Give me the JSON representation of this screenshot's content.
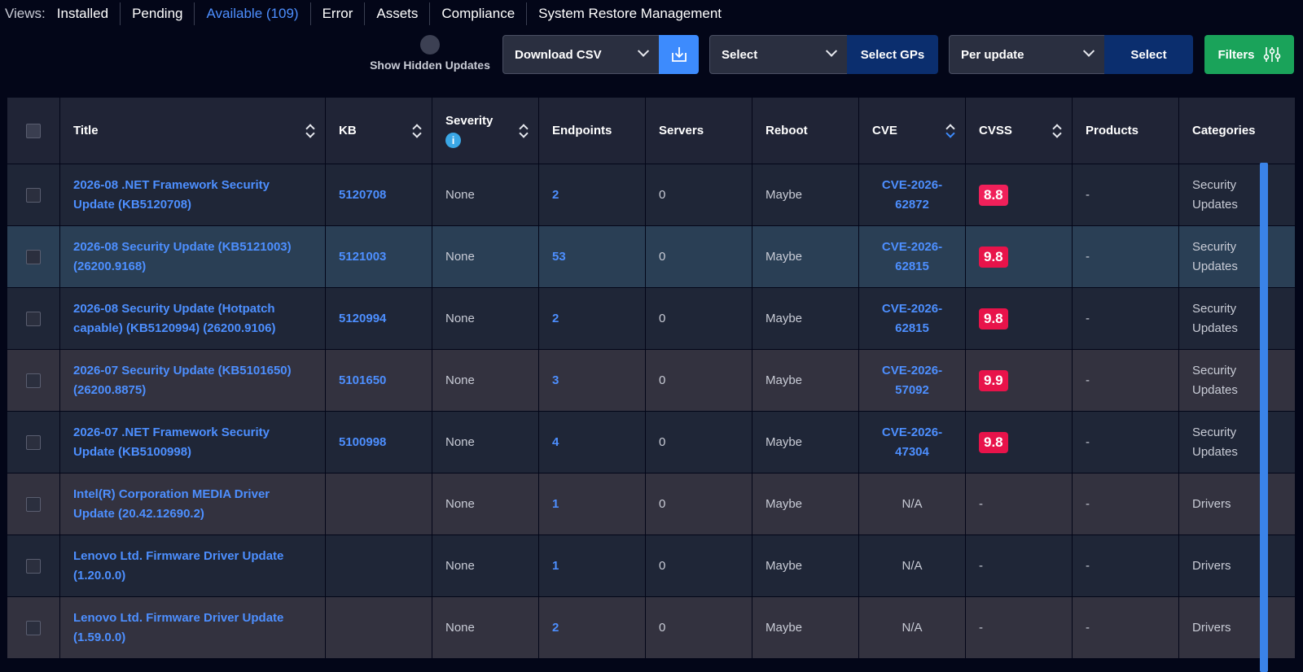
{
  "views": {
    "label": "Views:",
    "tabs": [
      {
        "label": "Installed",
        "active": false
      },
      {
        "label": "Pending",
        "active": false
      },
      {
        "label": "Available (109)",
        "active": true
      },
      {
        "label": "Error",
        "active": false
      },
      {
        "label": "Assets",
        "active": false
      },
      {
        "label": "Compliance",
        "active": false
      },
      {
        "label": "System Restore Management",
        "active": false
      }
    ]
  },
  "toolbar": {
    "hidden_updates_label": "Show Hidden Updates",
    "download_csv_label": "Download CSV",
    "download_icon": "download-icon",
    "group_select_value": "Select",
    "select_gps_label": "Select GPs",
    "per_update_value": "Per update",
    "select_label": "Select",
    "filters_label": "Filters",
    "filters_icon": "sliders-icon"
  },
  "colors": {
    "accent": "#4d8fff",
    "filters": "#1aa35a",
    "cvss_badge": "#e8134a"
  },
  "table": {
    "headers": {
      "title": "Title",
      "kb": "KB",
      "severity": "Severity",
      "endpoints": "Endpoints",
      "servers": "Servers",
      "reboot": "Reboot",
      "cve": "CVE",
      "cvss": "CVSS",
      "products": "Products",
      "categories": "Categories"
    },
    "rows": [
      {
        "title": "2026-08 .NET Framework Security Update (KB5120708)",
        "kb": "5120708",
        "severity": "None",
        "endpoints": "2",
        "servers": "0",
        "reboot": "Maybe",
        "cve": "CVE-2026-62872",
        "cvss": "8.8",
        "products": "-",
        "categories": "Security Updates"
      },
      {
        "title": "2026-08 Security Update (KB5121003) (26200.9168)",
        "kb": "5121003",
        "severity": "None",
        "endpoints": "53",
        "servers": "0",
        "reboot": "Maybe",
        "cve": "CVE-2026-62815",
        "cvss": "9.8",
        "products": "-",
        "categories": "Security Updates"
      },
      {
        "title": "2026-08 Security Update (Hotpatch capable) (KB5120994) (26200.9106)",
        "kb": "5120994",
        "severity": "None",
        "endpoints": "2",
        "servers": "0",
        "reboot": "Maybe",
        "cve": "CVE-2026-62815",
        "cvss": "9.8",
        "products": "-",
        "categories": "Security Updates"
      },
      {
        "title": "2026-07 Security Update (KB5101650) (26200.8875)",
        "kb": "5101650",
        "severity": "None",
        "endpoints": "3",
        "servers": "0",
        "reboot": "Maybe",
        "cve": "CVE-2026-57092",
        "cvss": "9.9",
        "products": "-",
        "categories": "Security Updates"
      },
      {
        "title": "2026-07 .NET Framework Security Update (KB5100998)",
        "kb": "5100998",
        "severity": "None",
        "endpoints": "4",
        "servers": "0",
        "reboot": "Maybe",
        "cve": "CVE-2026-47304",
        "cvss": "9.8",
        "products": "-",
        "categories": "Security Updates"
      },
      {
        "title": "Intel(R) Corporation MEDIA Driver Update (20.42.12690.2)",
        "kb": "",
        "severity": "None",
        "endpoints": "1",
        "servers": "0",
        "reboot": "Maybe",
        "cve": "N/A",
        "cvss": "-",
        "products": "-",
        "categories": "Drivers"
      },
      {
        "title": "Lenovo Ltd. Firmware Driver Update (1.20.0.0)",
        "kb": "",
        "severity": "None",
        "endpoints": "1",
        "servers": "0",
        "reboot": "Maybe",
        "cve": "N/A",
        "cvss": "-",
        "products": "-",
        "categories": "Drivers"
      },
      {
        "title": "Lenovo Ltd. Firmware Driver Update (1.59.0.0)",
        "kb": "",
        "severity": "None",
        "endpoints": "2",
        "servers": "0",
        "reboot": "Maybe",
        "cve": "N/A",
        "cvss": "-",
        "products": "-",
        "categories": "Drivers"
      }
    ]
  }
}
